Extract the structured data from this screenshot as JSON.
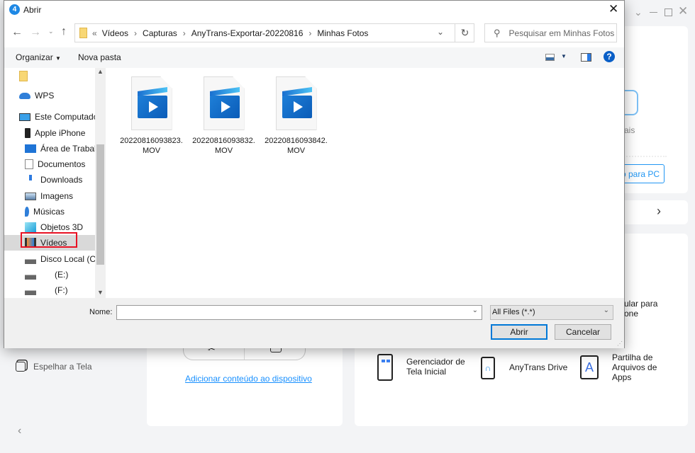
{
  "app": {
    "window_controls": [
      "chevron-down-icon",
      "minimize-icon",
      "maximize-icon",
      "close-icon"
    ],
    "partial_texts": {
      "more_label": "ais",
      "export_button": "do para PC",
      "phone_label_1": "ular para",
      "phone_label_2": "one"
    },
    "sidebar": {
      "mirror_label": "Espelhar a Tela"
    },
    "add_content_link": "Adicionar conteúdo ao dispositivo",
    "tools": [
      {
        "label": "Gerenciador de Tela Inicial",
        "icon": "home-screen-icon"
      },
      {
        "label": "AnyTrans Drive",
        "icon": "usb-drive-icon"
      },
      {
        "label": "Partilha de Arquivos de Apps",
        "icon": "app-store-file-icon"
      }
    ],
    "accent": "#1890ff"
  },
  "dialog": {
    "title": "Abrir",
    "breadcrumb": {
      "prefix": "«",
      "items": [
        "Vídeos",
        "Capturas",
        "AnyTrans-Exportar-20220816",
        "Minhas Fotos"
      ]
    },
    "search_placeholder": "Pesquisar em Minhas Fotos",
    "toolbar": {
      "organize": "Organizar",
      "new_folder": "Nova pasta"
    },
    "nav": [
      {
        "label": "",
        "icon": "folder-icon"
      },
      {
        "label": "WPS",
        "icon": "cloud-icon"
      },
      {
        "label": "Este Computador",
        "icon": "computer-icon"
      },
      {
        "label": "Apple iPhone",
        "icon": "phone-icon"
      },
      {
        "label": "Área de Trabalho",
        "icon": "desktop-icon"
      },
      {
        "label": "Documentos",
        "icon": "documents-icon"
      },
      {
        "label": "Downloads",
        "icon": "download-icon"
      },
      {
        "label": "Imagens",
        "icon": "pictures-icon"
      },
      {
        "label": "Músicas",
        "icon": "music-icon"
      },
      {
        "label": "Objetos 3D",
        "icon": "cube-icon"
      },
      {
        "label": "Vídeos",
        "icon": "video-icon",
        "selected": true
      },
      {
        "label": "Disco Local (C:)",
        "icon": "drive-icon"
      },
      {
        "label": "(E:)",
        "icon": "drive-icon"
      },
      {
        "label": "(F:)",
        "icon": "drive-icon"
      }
    ],
    "files": [
      {
        "name1": "20220816093823.",
        "name2": "MOV"
      },
      {
        "name1": "20220816093832.",
        "name2": "MOV"
      },
      {
        "name1": "20220816093842.",
        "name2": "MOV"
      }
    ],
    "filename_label": "Nome:",
    "filename_value": "",
    "filter": "All Files (*.*)",
    "open_button": "Abrir",
    "cancel_button": "Cancelar",
    "highlight_color": "#e81123"
  }
}
